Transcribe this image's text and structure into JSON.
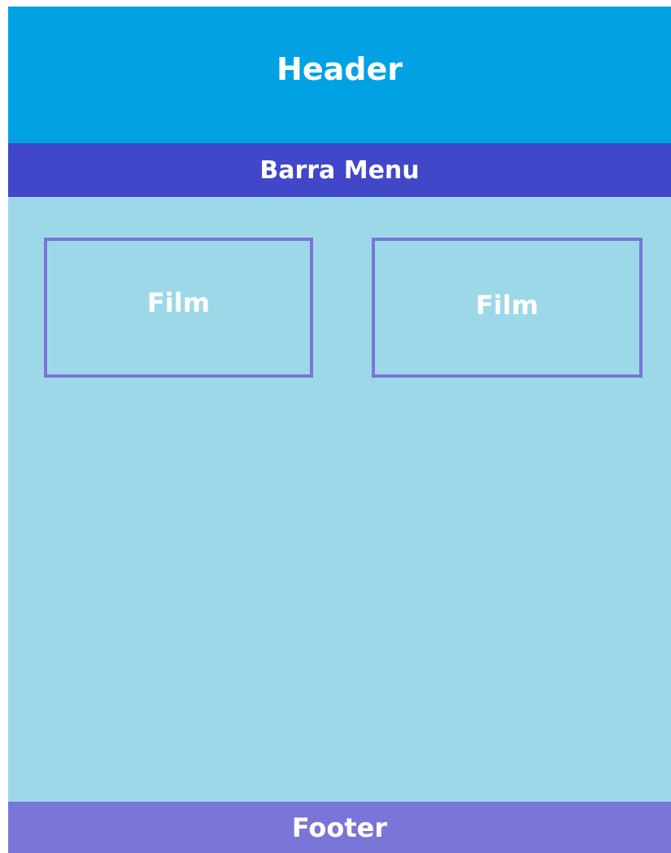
{
  "header": {
    "title": "Header",
    "color": "#00a2e3"
  },
  "menu_bar": {
    "label": "Barra Menu",
    "color": "#4047c8"
  },
  "content": {
    "background": "#9dd8e9",
    "films": [
      {
        "label": "Film"
      },
      {
        "label": "Film"
      }
    ]
  },
  "footer": {
    "label": "Footer",
    "color": "#7a75d6"
  }
}
